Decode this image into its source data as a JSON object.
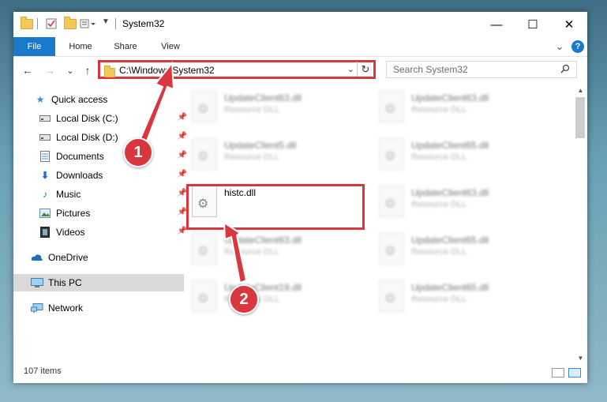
{
  "window": {
    "title": "System32",
    "controls": {
      "minimize": "—",
      "maximize": "☐",
      "close": "✕"
    }
  },
  "ribbon": {
    "tabs": [
      "File",
      "Home",
      "Share",
      "View"
    ],
    "collapse": "⌄",
    "help": "?"
  },
  "nav": {
    "back": "←",
    "forward": "→",
    "recent": "⌄",
    "up": "↑"
  },
  "address": {
    "path": "C:\\Windows\\System32",
    "dropdown": "⌄",
    "refresh": "↻"
  },
  "search": {
    "placeholder": "Search System32",
    "icon": "search-icon"
  },
  "sidebar": {
    "items": [
      {
        "label": "Quick access",
        "icon": "star-icon",
        "pinned": false
      },
      {
        "label": "Local Disk (C:)",
        "icon": "drive-icon",
        "pinned": true
      },
      {
        "label": "Local Disk (D:)",
        "icon": "drive-icon",
        "pinned": true
      },
      {
        "label": "Documents",
        "icon": "documents-icon",
        "pinned": true
      },
      {
        "label": "Downloads",
        "icon": "download-icon",
        "pinned": true
      },
      {
        "label": "Music",
        "icon": "music-icon",
        "pinned": true
      },
      {
        "label": "Pictures",
        "icon": "pictures-icon",
        "pinned": true
      },
      {
        "label": "Videos",
        "icon": "videos-icon",
        "pinned": true
      },
      {
        "label": "OneDrive",
        "icon": "cloud-icon",
        "pinned": false
      },
      {
        "label": "This PC",
        "icon": "computer-icon",
        "pinned": false,
        "selected": true
      },
      {
        "label": "Network",
        "icon": "network-icon",
        "pinned": false
      }
    ]
  },
  "files": {
    "left": [
      {
        "name": "UpdateClient63.dll",
        "type": "Resource DLL",
        "blurred": true
      },
      {
        "name": "UpdateClient5.dll",
        "type": "Resource DLL",
        "blurred": true
      },
      {
        "name": "histc.dll",
        "type": "",
        "blurred": false
      },
      {
        "name": "UpdateClient63.dll",
        "type": "Resource DLL",
        "blurred": true
      },
      {
        "name": "UpdateClient19.dll",
        "type": "Resource DLL",
        "blurred": true
      }
    ],
    "right": [
      {
        "name": "UpdateClient63.dll",
        "type": "Resource DLL",
        "blurred": true
      },
      {
        "name": "UpdateClient65.dll",
        "type": "Resource DLL",
        "blurred": true
      },
      {
        "name": "UpdateClient63.dll",
        "type": "Resource DLL",
        "blurred": true
      },
      {
        "name": "UpdateClient65.dll",
        "type": "Resource DLL",
        "blurred": true
      },
      {
        "name": "UpdateClient65.dll",
        "type": "Resource DLL",
        "blurred": true
      }
    ]
  },
  "status": {
    "item_count": "107 items"
  },
  "callouts": [
    "1",
    "2"
  ],
  "colors": {
    "accent": "#1979ca",
    "highlight": "#d9363e",
    "selected": "#d9d9d9"
  }
}
